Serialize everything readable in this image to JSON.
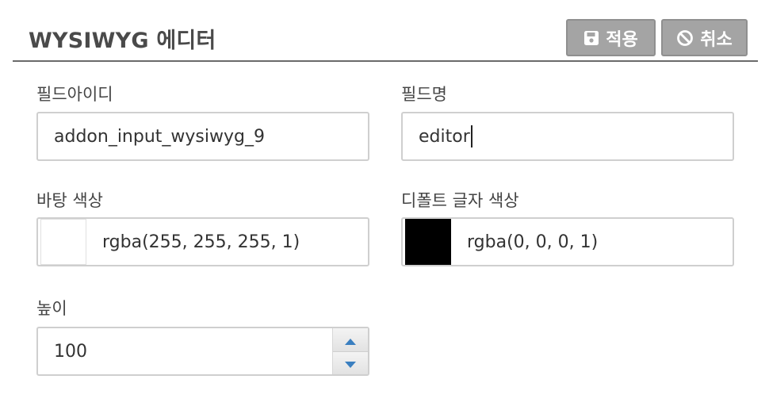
{
  "header": {
    "title": "WYSIWYG 에디터",
    "apply_label": "적용",
    "cancel_label": "취소"
  },
  "fields": {
    "field_id": {
      "label": "필드아이디",
      "value": "addon_input_wysiwyg_9"
    },
    "field_name": {
      "label": "필드명",
      "value": "editor"
    },
    "bg_color": {
      "label": "바탕 색상",
      "value": "rgba(255, 255, 255, 1)",
      "swatch": "#ffffff"
    },
    "text_color": {
      "label": "디폴트 글자 색상",
      "value": "rgba(0, 0, 0, 1)",
      "swatch": "#000000"
    },
    "height": {
      "label": "높이",
      "value": "100"
    }
  },
  "colors": {
    "button_bg": "#a4a4a4",
    "spinner_arrow": "#3a7fc0",
    "header_rule": "#6b6b6b"
  },
  "icons": {
    "apply": "floppy-disk-icon",
    "cancel": "ban-icon",
    "spin_up": "triangle-up-icon",
    "spin_down": "triangle-down-icon"
  }
}
